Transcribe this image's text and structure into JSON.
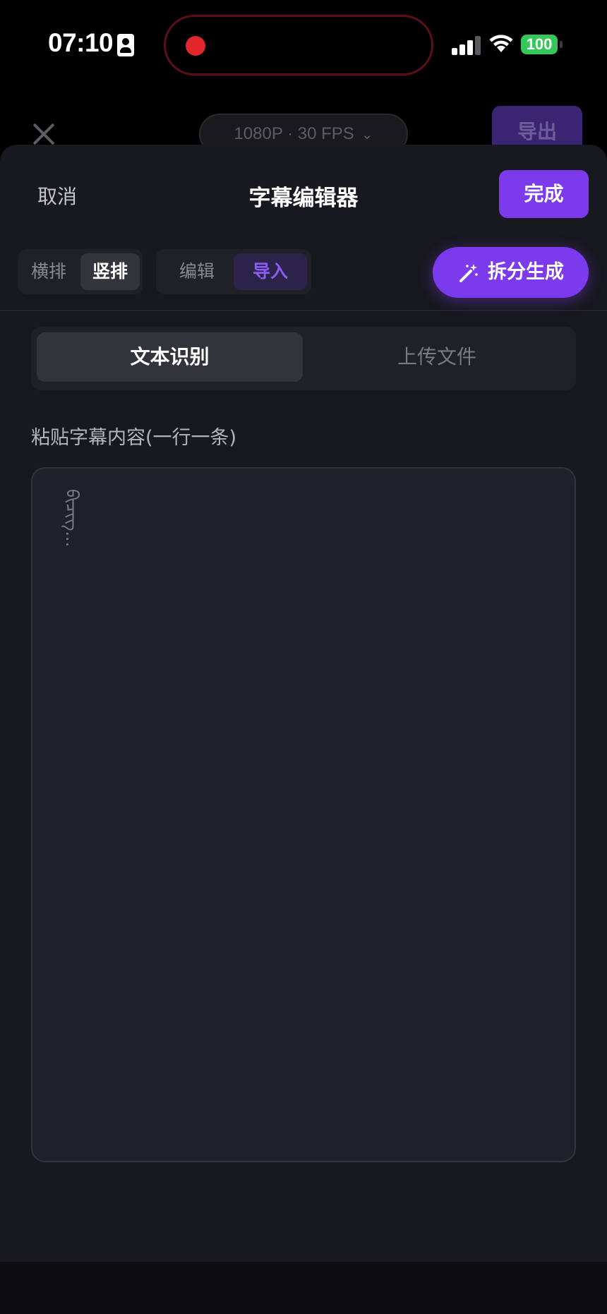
{
  "status_bar": {
    "time": "07:10",
    "battery": "100"
  },
  "background_bar": {
    "quality": "1080P · 30 FPS",
    "export_label": "导出"
  },
  "sheet": {
    "cancel_label": "取消",
    "title": "字幕编辑器",
    "done_label": "完成",
    "orientation": {
      "options": [
        "横排",
        "竖排"
      ],
      "selected": "竖排"
    },
    "mode": {
      "options": [
        "编辑",
        "导入"
      ],
      "selected": "导入"
    },
    "split_generate_label": "拆分生成",
    "source_tabs": {
      "options": [
        "文本识别",
        "上传文件"
      ],
      "selected": "文本识别"
    },
    "paste_label": "粘贴字幕内容(一行一条)",
    "textarea_placeholder": "ᠪᠢᠴᠢᠭ᠌..."
  },
  "colors": {
    "accent": "#7c3aed",
    "sheet_bg": "#181820",
    "record_dot": "#e0282c",
    "battery": "#34c759"
  },
  "icons": {
    "close": "close-icon",
    "chevron": "chevron-down-icon",
    "wand": "magic-wand-icon",
    "signal": "cellular-signal-icon",
    "wifi": "wifi-icon",
    "contact": "contact-card-icon"
  }
}
